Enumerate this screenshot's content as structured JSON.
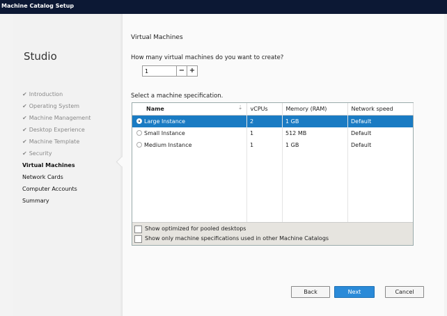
{
  "window": {
    "title": "Machine Catalog Setup"
  },
  "sidebar": {
    "brand": "Studio",
    "steps": [
      {
        "label": "Introduction",
        "state": "done"
      },
      {
        "label": "Operating System",
        "state": "done"
      },
      {
        "label": "Machine Management",
        "state": "done"
      },
      {
        "label": "Desktop Experience",
        "state": "done"
      },
      {
        "label": "Machine Template",
        "state": "done"
      },
      {
        "label": "Security",
        "state": "done"
      },
      {
        "label": "Virtual Machines",
        "state": "active"
      },
      {
        "label": "Network Cards",
        "state": "todo"
      },
      {
        "label": "Computer Accounts",
        "state": "todo"
      },
      {
        "label": "Summary",
        "state": "todo"
      }
    ]
  },
  "main": {
    "heading": "Virtual Machines",
    "question": "How many virtual machines do you want to create?",
    "vm_count": "1",
    "minus": "−",
    "plus": "+",
    "spec_label": "Select a machine specification.",
    "table": {
      "columns": [
        "Name",
        "vCPUs",
        "Memory (RAM)",
        "Network speed"
      ],
      "rows": [
        {
          "name": "Large Instance",
          "vcpus": "2",
          "memory": "1 GB",
          "network": "Default",
          "selected": true
        },
        {
          "name": "Small Instance",
          "vcpus": "1",
          "memory": "512 MB",
          "network": "Default",
          "selected": false
        },
        {
          "name": "Medium Instance",
          "vcpus": "1",
          "memory": "1 GB",
          "network": "Default",
          "selected": false
        }
      ]
    },
    "filters": {
      "pooled": "Show optimized for pooled desktops",
      "used_only": "Show only machine specifications used in other Machine Catalogs"
    }
  },
  "footer": {
    "back": "Back",
    "next": "Next",
    "cancel": "Cancel"
  },
  "colors": {
    "titlebar": "#0c1834",
    "selection": "#1a7bc3",
    "primary": "#2a8ad8"
  }
}
